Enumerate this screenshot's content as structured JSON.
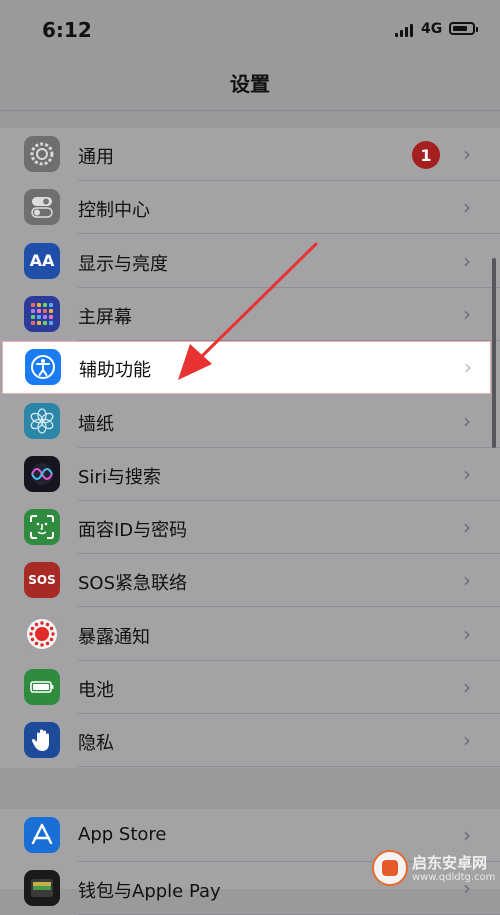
{
  "status_bar": {
    "time": "6:12",
    "network": "4G"
  },
  "nav": {
    "title": "设置"
  },
  "group1": [
    {
      "name": "general",
      "label": "通用",
      "icon": "gear-icon",
      "color": "#6f6f72",
      "badge": "1"
    },
    {
      "name": "control-center",
      "label": "控制中心",
      "icon": "toggle-icon",
      "color": "#6f6f72"
    },
    {
      "name": "display-brightness",
      "label": "显示与亮度",
      "icon": "text-size-icon",
      "color": "#1f4fa8",
      "glyph": "AA"
    },
    {
      "name": "home-screen",
      "label": "主屏幕",
      "icon": "app-grid-icon",
      "color": "#2a3b9a"
    },
    {
      "name": "accessibility",
      "label": "辅助功能",
      "icon": "accessibility-icon",
      "color": "#1a7cf2",
      "highlighted": true
    },
    {
      "name": "wallpaper",
      "label": "墙纸",
      "icon": "flower-icon",
      "color": "#2b86a8"
    },
    {
      "name": "siri-search",
      "label": "Siri与搜索",
      "icon": "siri-icon",
      "color": "#151520"
    },
    {
      "name": "face-id-passcode",
      "label": "面容ID与密码",
      "icon": "face-id-icon",
      "color": "#2f8c3e"
    },
    {
      "name": "emergency-sos",
      "label": "SOS紧急联络",
      "icon": "sos-icon",
      "color": "#a82a25",
      "glyph": "SOS"
    },
    {
      "name": "exposure-notifications",
      "label": "暴露通知",
      "icon": "exposure-icon",
      "color": "#a3a3a6"
    },
    {
      "name": "battery",
      "label": "电池",
      "icon": "battery-icon",
      "color": "#2f8c3e"
    },
    {
      "name": "privacy",
      "label": "隐私",
      "icon": "hand-icon",
      "color": "#1e4a9a"
    }
  ],
  "group2": [
    {
      "name": "app-store",
      "label": "App Store",
      "icon": "app-store-icon",
      "color": "#1a6fd6"
    },
    {
      "name": "wallet-apple-pay",
      "label": "钱包与Apple Pay",
      "icon": "wallet-icon",
      "color": "#1a1a1a"
    }
  ],
  "watermark": {
    "title": "启东安卓网",
    "url": "www.qdldtg.com"
  },
  "colors": {
    "badge": "#a51f1f",
    "arrow": "#e83232",
    "dim_background": "#9a9a9d"
  }
}
